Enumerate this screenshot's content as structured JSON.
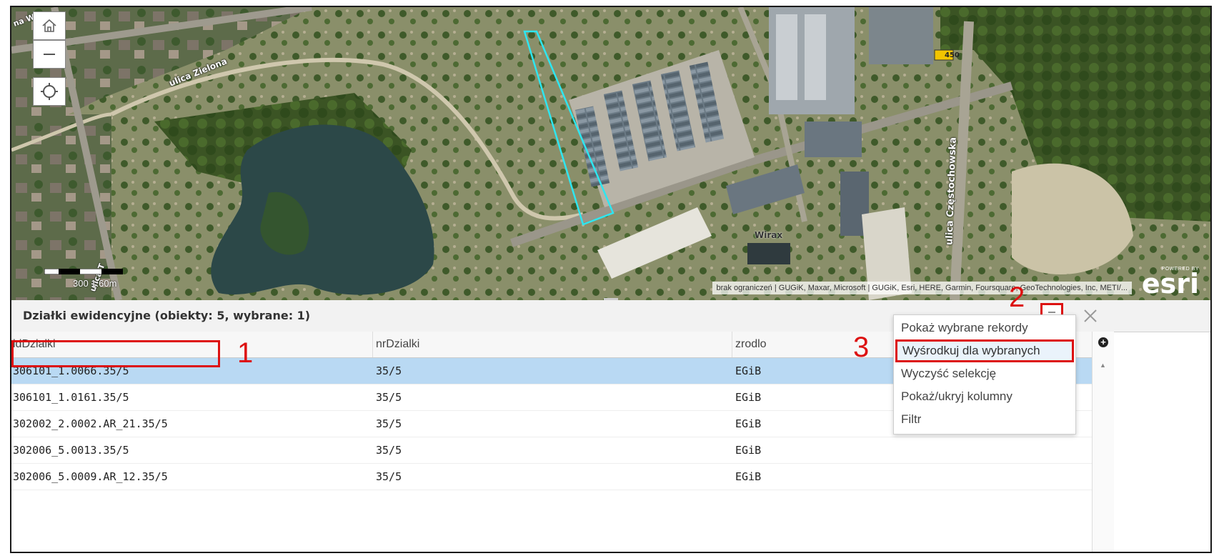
{
  "map": {
    "road_labels": [
      "ulica Zielona",
      "ulica Częstochowska",
      "ulica T",
      "na W"
    ],
    "road_shield": "450",
    "building_label": "Wirax",
    "scale_text": "300 1:60m",
    "attribution": "brak ograniczeń | GUGiK, Maxar, Microsoft | GUGiK, Esri, HERE, Garmin, Foursquare, GeoTechnologies, Inc, METI/...",
    "esri_powered": "POWERED BY",
    "esri_logo": "esri",
    "controls": [
      "home-icon",
      "zoom-out-icon",
      "locate-icon"
    ],
    "parcel_outline_color": "#2ee6f0"
  },
  "panel": {
    "title": "Działki ewidencyjne (obiekty: 5, wybrane: 1)",
    "menu_icon": "menu-icon",
    "close_icon": "close-icon",
    "columns": [
      "idDzialki",
      "nrDzialki",
      "zrodlo"
    ],
    "rows": [
      {
        "id": "306101_1.0066.35/5",
        "nr": "35/5",
        "zrodlo": "EGiB",
        "selected": true
      },
      {
        "id": "306101_1.0161.35/5",
        "nr": "35/5",
        "zrodlo": "EGiB",
        "selected": false
      },
      {
        "id": "302002_2.0002.AR_21.35/5",
        "nr": "35/5",
        "zrodlo": "EGiB",
        "selected": false
      },
      {
        "id": "302006_5.0013.35/5",
        "nr": "35/5",
        "zrodlo": "EGiB",
        "selected": false
      },
      {
        "id": "302006_5.0009.AR_12.35/5",
        "nr": "35/5",
        "zrodlo": "EGiB",
        "selected": false
      }
    ]
  },
  "menu": {
    "items": [
      "Pokaż wybrane rekordy",
      "Wyśrodkuj dla wybranych",
      "Wyczyść selekcję",
      "Pokaż/ukryj kolumny",
      "Filtr"
    ]
  },
  "annotations": {
    "n1": "1",
    "n2": "2",
    "n3": "3",
    "color": "#dd1111"
  }
}
